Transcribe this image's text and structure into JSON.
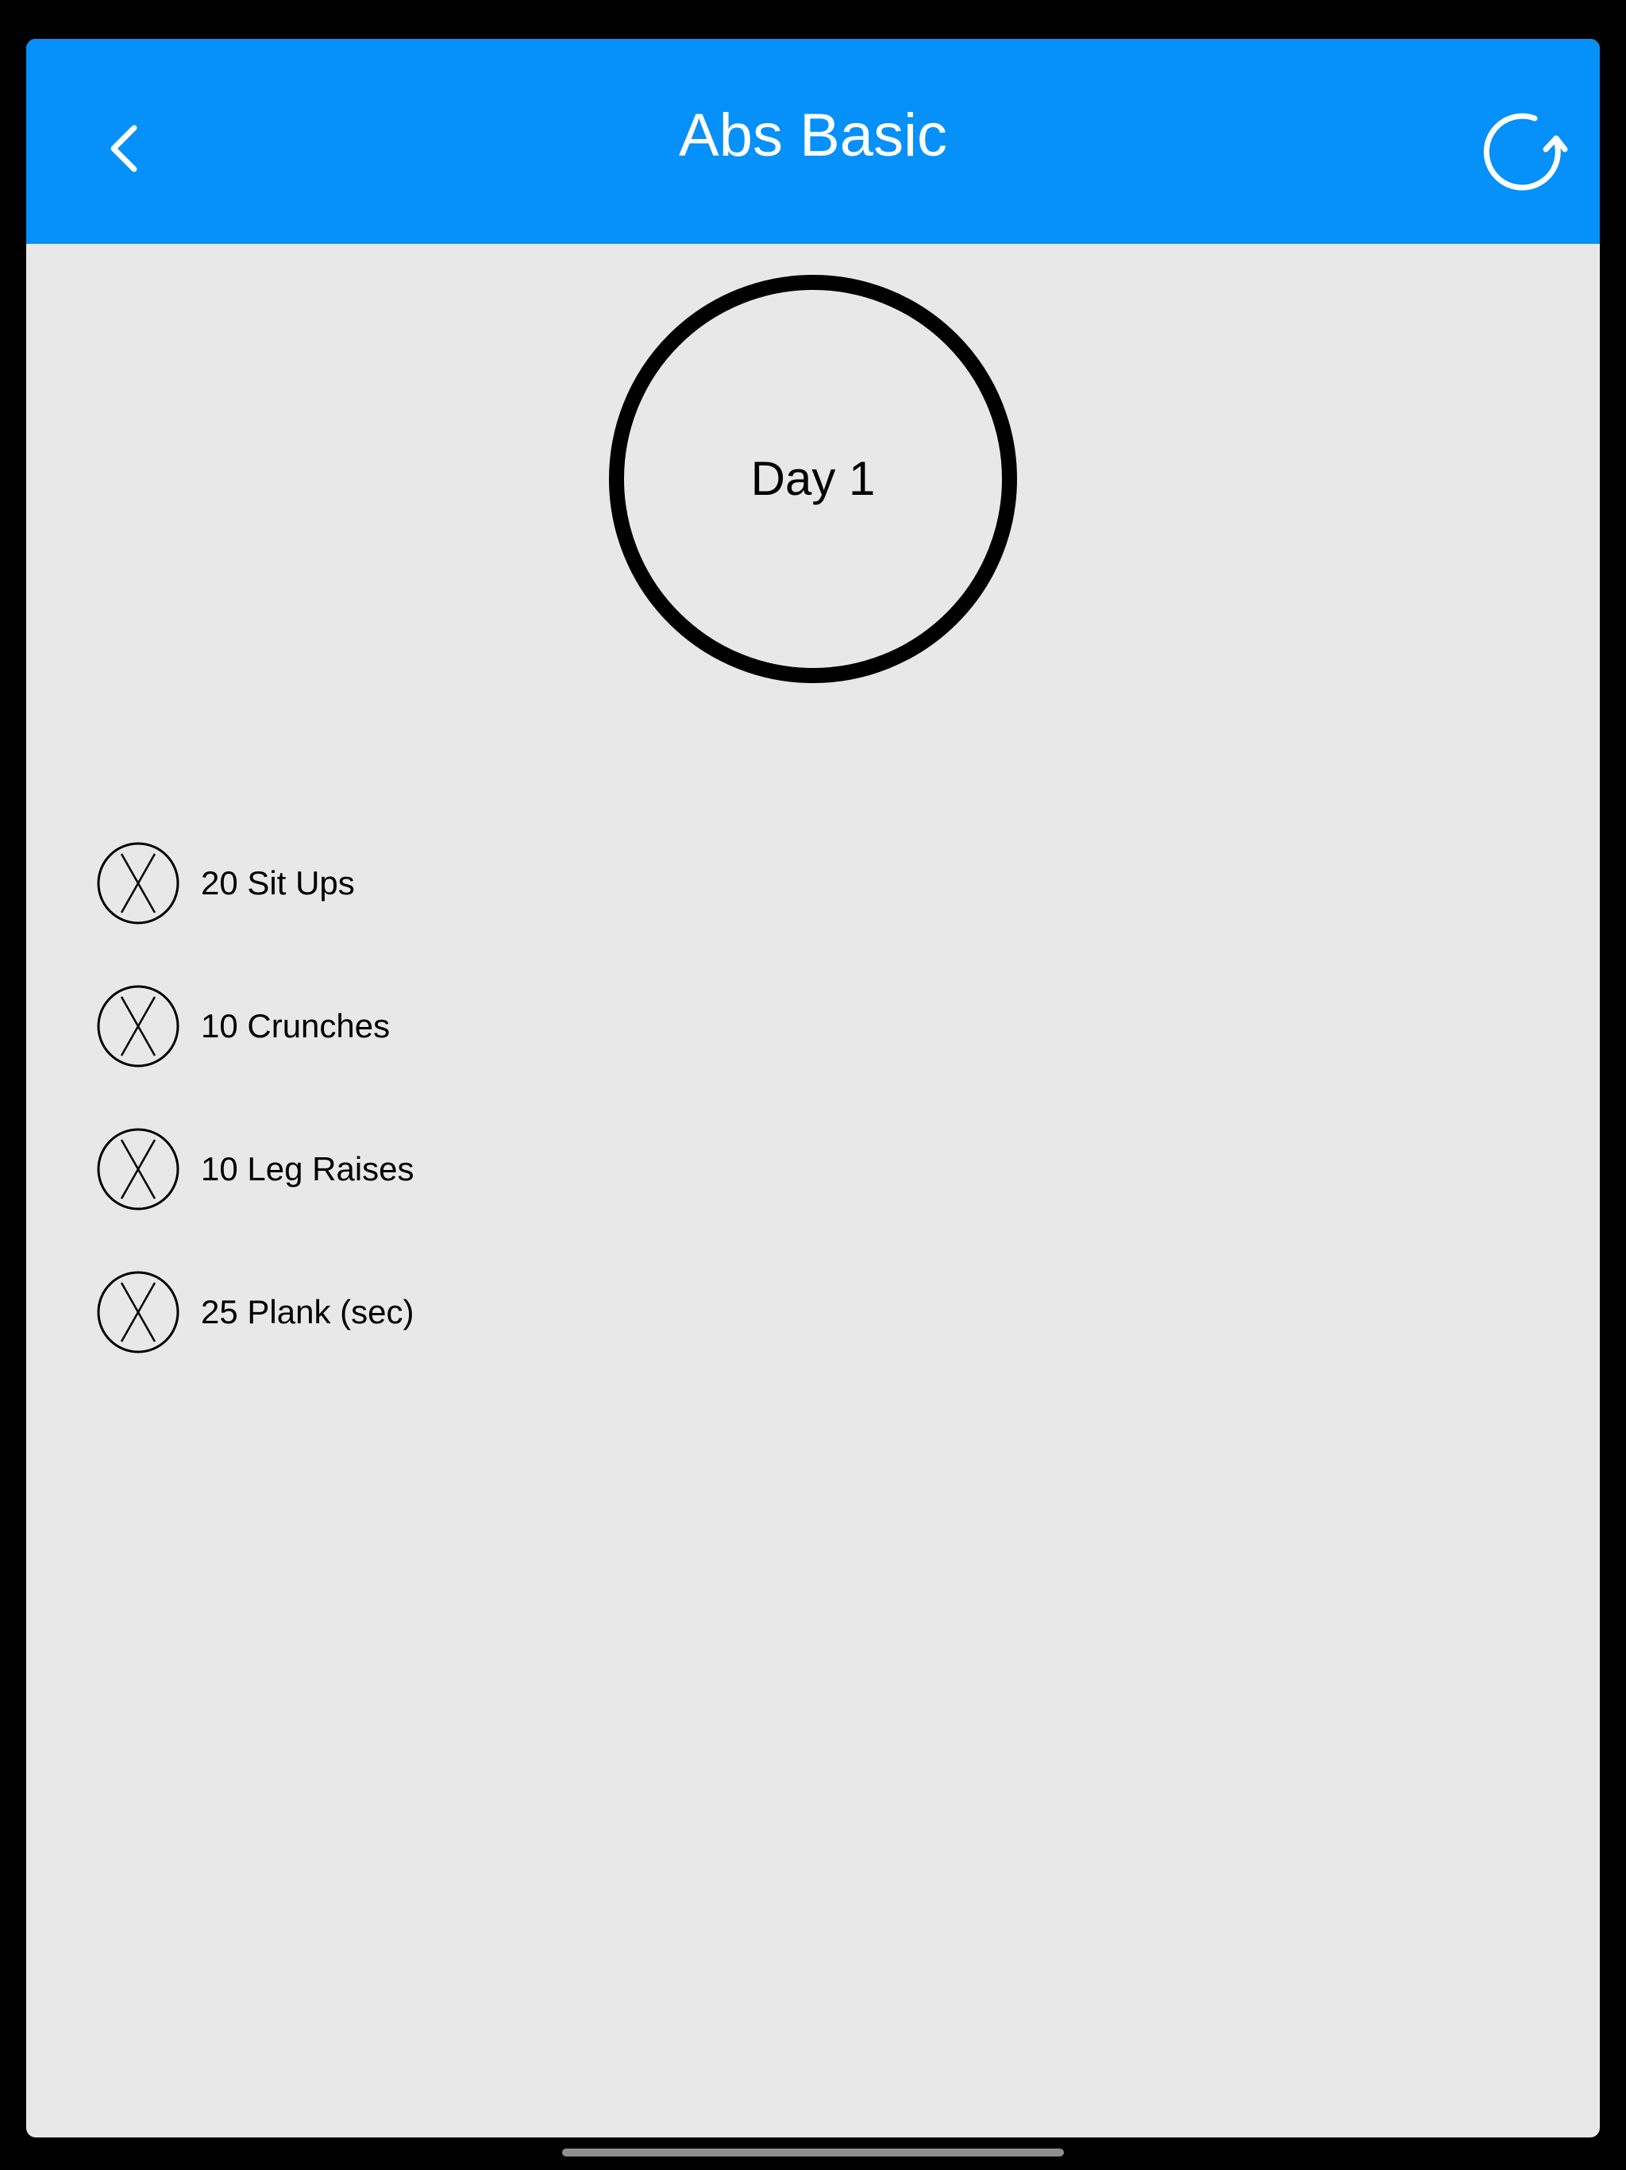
{
  "nav": {
    "title": "Abs Basic",
    "back_icon": "chevron-left-icon",
    "reset_icon": "refresh-icon",
    "background_color": "#0690fa"
  },
  "day": {
    "label": "Day 1"
  },
  "exercises": [
    {
      "label": "20 Sit Ups",
      "status_icon": "circle-x-icon"
    },
    {
      "label": "10 Crunches",
      "status_icon": "circle-x-icon"
    },
    {
      "label": "10 Leg Raises",
      "status_icon": "circle-x-icon"
    },
    {
      "label": "25 Plank (sec)",
      "status_icon": "circle-x-icon"
    }
  ]
}
